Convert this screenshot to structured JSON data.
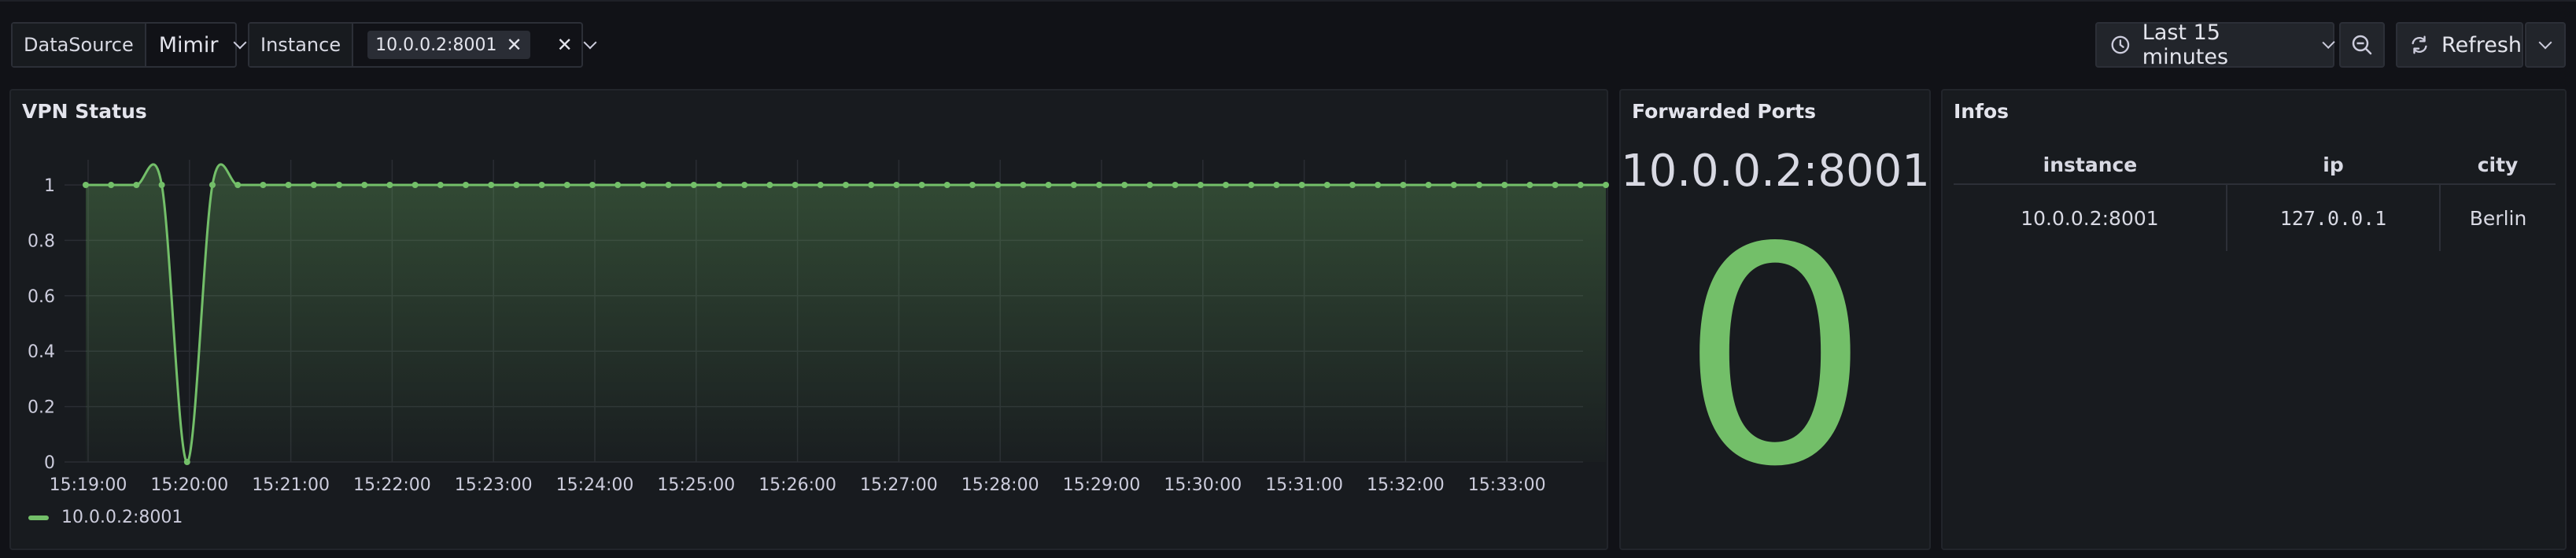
{
  "variables": {
    "datasource": {
      "label": "DataSource",
      "value": "Mimir"
    },
    "instance": {
      "label": "Instance",
      "chip": "10.0.0.2:8001",
      "chip_remove": "✕",
      "clear": "✕"
    }
  },
  "toolbar": {
    "time_range": "Last 15 minutes",
    "refresh": "Refresh",
    "icons": [
      "clock-icon",
      "chevron-down-icon",
      "zoom-out-icon",
      "refresh-icon"
    ]
  },
  "panels": {
    "vpn": {
      "title": "VPN Status",
      "legend": "10.0.0.2:8001"
    },
    "ports": {
      "title": "Forwarded Ports",
      "instance": "10.0.0.2:8001",
      "value": "0"
    },
    "infos": {
      "title": "Infos",
      "headers": [
        "instance",
        "ip",
        "city"
      ],
      "rows": [
        [
          "10.0.0.2:8001",
          "127.0.0.1",
          "Berlin"
        ]
      ]
    }
  },
  "colors": {
    "series": "#73bf69",
    "background": "#111217",
    "panel": "#181b1f"
  },
  "chart_data": {
    "type": "line",
    "title": "VPN Status",
    "x_ticks": [
      "15:19:00",
      "15:20:00",
      "15:21:00",
      "15:22:00",
      "15:23:00",
      "15:24:00",
      "15:25:00",
      "15:26:00",
      "15:27:00",
      "15:28:00",
      "15:29:00",
      "15:30:00",
      "15:31:00",
      "15:32:00",
      "15:33:00"
    ],
    "y_ticks": [
      "0",
      "0.2",
      "0.4",
      "0.6",
      "0.8",
      "1"
    ],
    "ylim": [
      0,
      1
    ],
    "grid": true,
    "legend_placement": "bottom-left",
    "series": [
      {
        "name": "10.0.0.2:8001",
        "x_start": "15:18:50",
        "step_seconds": 15,
        "values": [
          1,
          1,
          1,
          1,
          0,
          1,
          1,
          1,
          1,
          1,
          1,
          1,
          1,
          1,
          1,
          1,
          1,
          1,
          1,
          1,
          1,
          1,
          1,
          1,
          1,
          1,
          1,
          1,
          1,
          1,
          1,
          1,
          1,
          1,
          1,
          1,
          1,
          1,
          1,
          1,
          1,
          1,
          1,
          1,
          1,
          1,
          1,
          1,
          1,
          1,
          1,
          1,
          1,
          1,
          1,
          1,
          1,
          1,
          1,
          1,
          1
        ]
      }
    ]
  }
}
